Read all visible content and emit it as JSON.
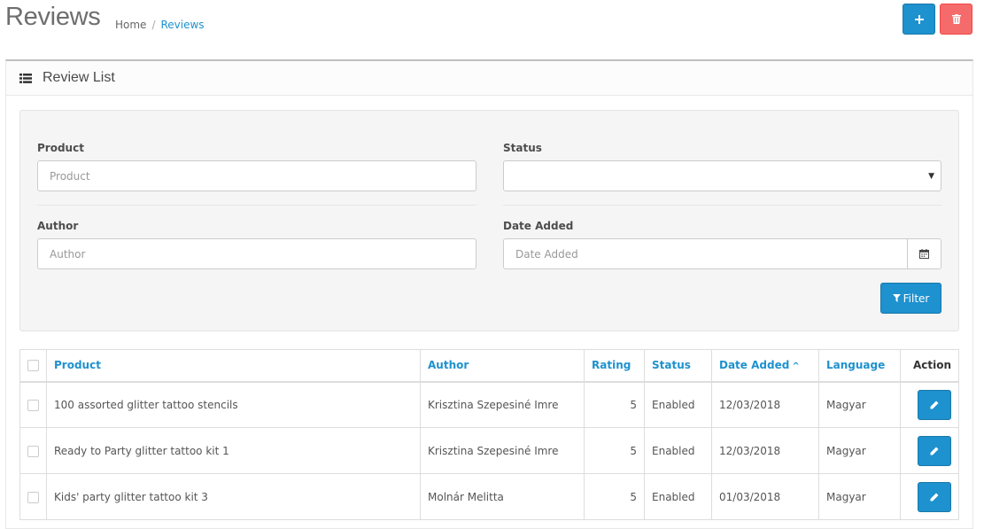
{
  "header": {
    "title": "Reviews",
    "breadcrumb": [
      {
        "label": "Home"
      },
      {
        "label": "Reviews"
      }
    ]
  },
  "panel": {
    "title": "Review List"
  },
  "filter": {
    "product_label": "Product",
    "product_placeholder": "Product",
    "status_label": "Status",
    "status_value": "",
    "author_label": "Author",
    "author_placeholder": "Author",
    "date_label": "Date Added",
    "date_placeholder": "Date Added",
    "filter_button": "Filter"
  },
  "table": {
    "headers": {
      "product": "Product",
      "author": "Author",
      "rating": "Rating",
      "status": "Status",
      "date_added": "Date Added",
      "language": "Language",
      "action": "Action"
    },
    "sort_indicator": "^",
    "rows": [
      {
        "product": "100 assorted glitter tattoo stencils",
        "author": "Krisztina Szepesiné Imre",
        "rating": "5",
        "status": "Enabled",
        "date_added": "12/03/2018",
        "language": "Magyar"
      },
      {
        "product": "Ready to Party glitter tattoo kit 1",
        "author": "Krisztina Szepesiné Imre",
        "rating": "5",
        "status": "Enabled",
        "date_added": "12/03/2018",
        "language": "Magyar"
      },
      {
        "product": "Kids' party glitter tattoo kit 3",
        "author": "Molnár Melitta",
        "rating": "5",
        "status": "Enabled",
        "date_added": "01/03/2018",
        "language": "Magyar"
      }
    ]
  },
  "colors": {
    "primary": "#1e91cf",
    "danger": "#f56b6b"
  },
  "icons": {
    "add": "plus-icon",
    "delete": "trash-icon",
    "list": "list-icon",
    "calendar": "calendar-icon",
    "filter": "filter-icon",
    "edit": "pencil-icon"
  }
}
